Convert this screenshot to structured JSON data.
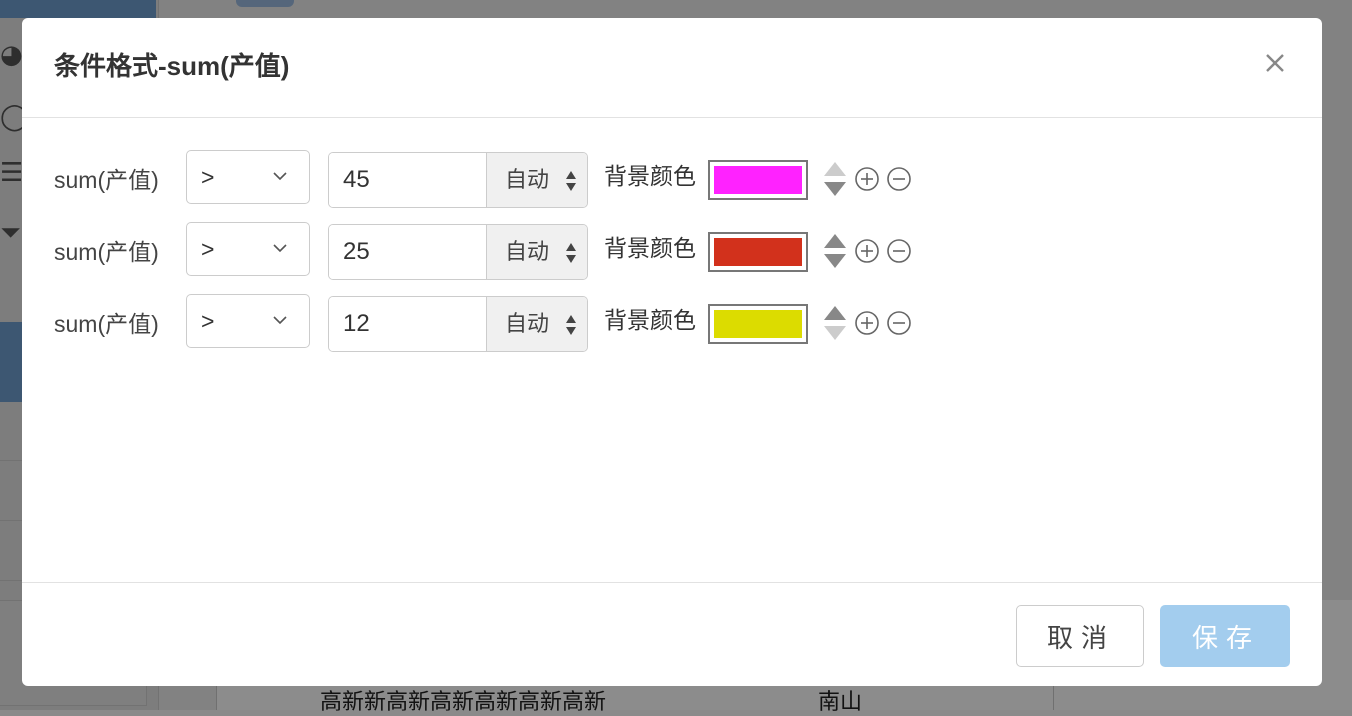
{
  "background": {
    "cell_text_1": "高新新高新高新高新高新高新",
    "cell_text_2": "南山"
  },
  "dialog": {
    "title": "条件格式-sum(产值)",
    "close_icon": "close-icon",
    "rules": [
      {
        "field": "sum(产值)",
        "operator": ">",
        "value": "45",
        "unit": "自动",
        "style_label": "背景颜色",
        "color": "#ff22ff",
        "up_enabled": false,
        "down_enabled": true
      },
      {
        "field": "sum(产值)",
        "operator": ">",
        "value": "25",
        "unit": "自动",
        "style_label": "背景颜色",
        "color": "#d2311c",
        "up_enabled": true,
        "down_enabled": true
      },
      {
        "field": "sum(产值)",
        "operator": ">",
        "value": "12",
        "unit": "自动",
        "style_label": "背景颜色",
        "color": "#dcdc00",
        "up_enabled": true,
        "down_enabled": false
      }
    ],
    "footer": {
      "cancel_label": "取消",
      "save_label": "保存"
    }
  },
  "colors": {
    "save_button": "#a3cdee",
    "arrow_enabled": "#888888",
    "arrow_disabled": "#cccccc"
  }
}
